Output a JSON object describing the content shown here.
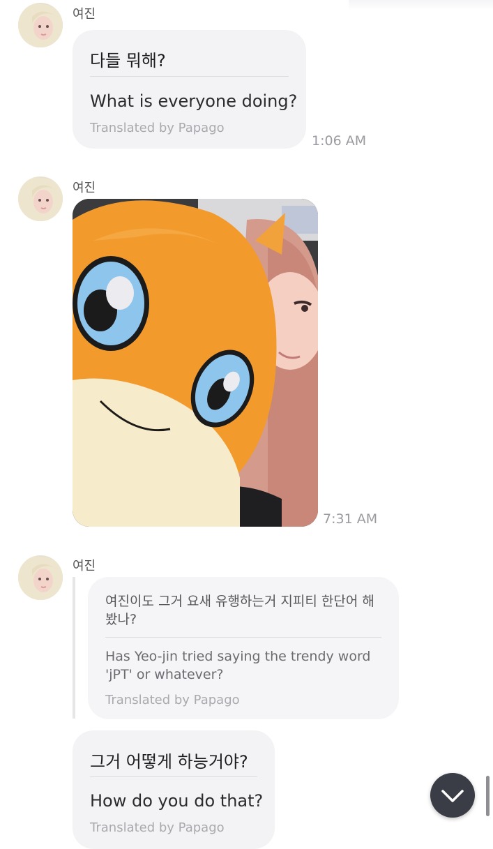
{
  "messages": [
    {
      "sender": "여진",
      "original": "다들 뭐해?",
      "translation": "What is everyone doing?",
      "credit": "Translated by Papago",
      "time": "1:06 AM"
    },
    {
      "sender": "여진",
      "time": "7:31 AM"
    },
    {
      "sender": "여진",
      "original_lines": [
        "여진이도 그거 요새 유행하는거 지피티 한단어 해",
        "봤나?"
      ],
      "translation_lines": [
        "Has Yeo-jin tried saying the trendy word",
        "'jPT' or whatever?"
      ],
      "credit": "Translated by Papago"
    },
    {
      "original": "그거 어떻게 하능거야?",
      "translation": "How do you do that?",
      "credit": "Translated by Papago"
    }
  ],
  "icons": {
    "scroll_down": "chevron-down-icon"
  },
  "colors": {
    "bubble": "#f3f3f5",
    "scroll_button": "#3a3d45"
  }
}
